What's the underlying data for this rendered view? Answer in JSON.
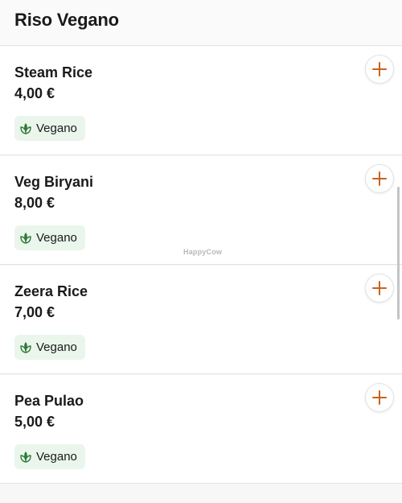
{
  "header": {
    "title": "Riso Vegano"
  },
  "items": [
    {
      "name": "Steam Rice",
      "price": "4,00 €",
      "badge": "Vegano"
    },
    {
      "name": "Veg Biryani",
      "price": "8,00 €",
      "badge": "Vegano"
    },
    {
      "name": "Zeera Rice",
      "price": "7,00 €",
      "badge": "Vegano"
    },
    {
      "name": "Pea Pulao",
      "price": "5,00 €",
      "badge": "Vegano"
    }
  ],
  "watermark": "HappyCow",
  "colors": {
    "accent": "#c8631b",
    "badge_bg": "#eaf6ec",
    "leaf_icon": "#2f7a3a"
  },
  "icons": {
    "add": "plus-icon",
    "badge": "leaf-icon"
  }
}
